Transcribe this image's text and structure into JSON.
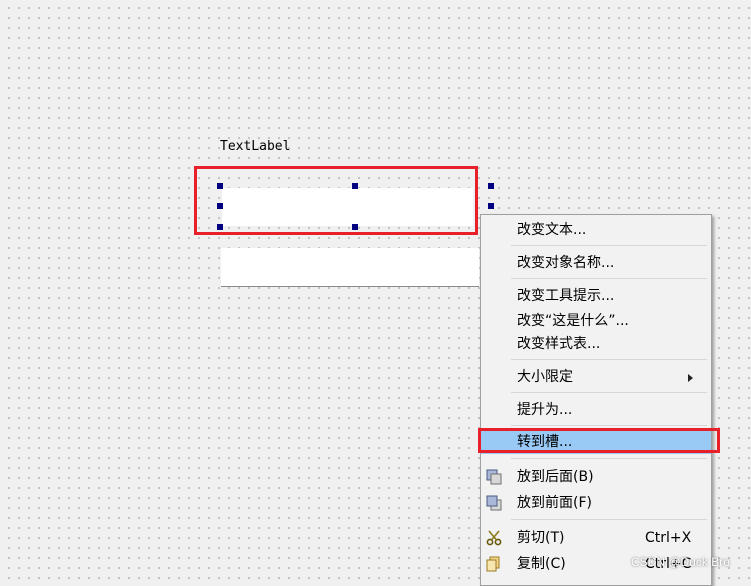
{
  "form": {
    "text_label": "TextLabel"
  },
  "context_menu": {
    "items": [
      {
        "label": "改变文本..."
      },
      {
        "label": "改变对象名称..."
      },
      {
        "label": "改变工具提示..."
      },
      {
        "label": "改变“这是什么”..."
      },
      {
        "label": "改变样式表..."
      },
      {
        "label": "大小限定"
      },
      {
        "label": "提升为..."
      },
      {
        "label": "转到槽..."
      },
      {
        "label": "放到后面(B)",
        "icon": "send-to-back-icon"
      },
      {
        "label": "放到前面(F)",
        "icon": "bring-to-front-icon"
      },
      {
        "label": "剪切(T)",
        "shortcut": "Ctrl+X",
        "icon": "scissors-icon"
      },
      {
        "label": "复制(C)",
        "shortcut": "Ctrl+C",
        "icon": "copy-icon"
      }
    ],
    "highlighted_item": "转到槽..."
  },
  "colors": {
    "highlight": "#99c9f5",
    "annotation_red": "#e8202a",
    "selection_handle": "#000080"
  },
  "watermark": "CSDN @Duck Bro"
}
